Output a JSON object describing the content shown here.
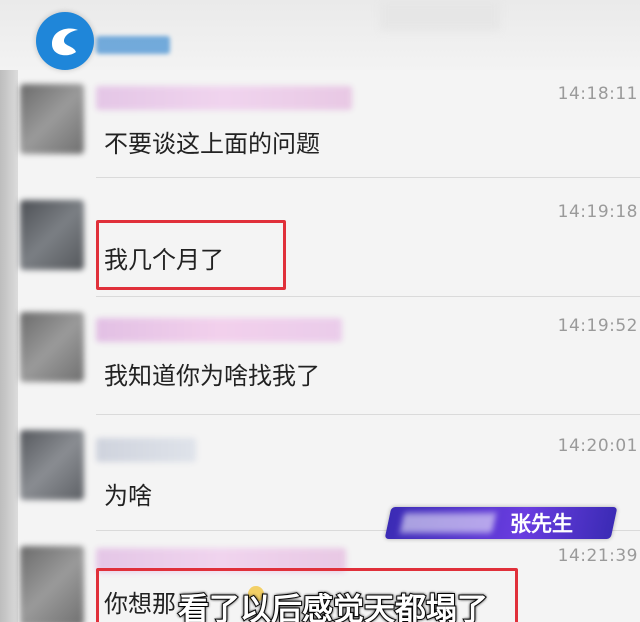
{
  "messages": [
    {
      "time": "14:18:11",
      "text": "不要谈这上面的问题"
    },
    {
      "time": "14:19:18",
      "text": "我几个月了"
    },
    {
      "time": "14:19:52",
      "text": "我知道你为啥找我了"
    },
    {
      "time": "14:20:01",
      "text": "为啥"
    },
    {
      "time": "14:21:39",
      "text": "你想那"
    }
  ],
  "overlay": {
    "speaker_name": "张先生",
    "caption": "看了以后感觉天都塌了"
  },
  "colors": {
    "highlight": "#e0303a",
    "lower_third": "#5a35d6",
    "logo": "#1f86d9"
  }
}
